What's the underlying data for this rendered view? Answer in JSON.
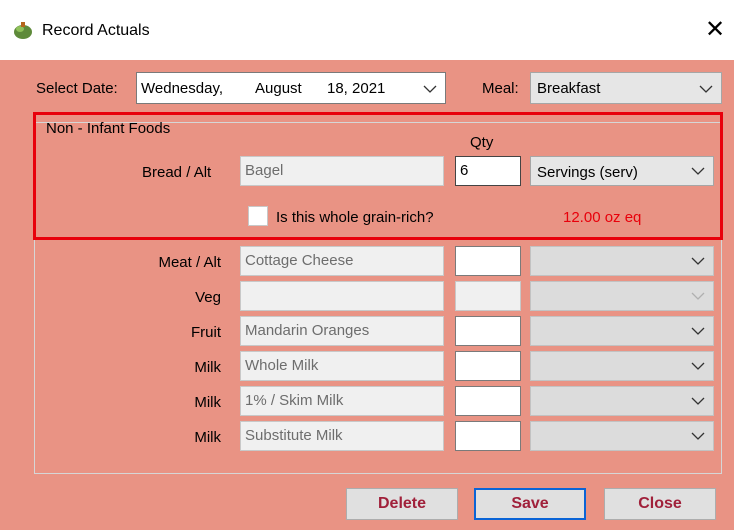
{
  "window": {
    "title": "Record Actuals",
    "close_glyph": "✕"
  },
  "date": {
    "label": "Select Date:",
    "weekday": "Wednesday,",
    "month": "August",
    "day_year": "18, 2021"
  },
  "meal": {
    "label": "Meal:",
    "value": "Breakfast"
  },
  "non_infant": {
    "group_label": "Non - Infant Foods",
    "qty_header": "Qty",
    "bread": {
      "label": "Bread / Alt",
      "food": "Bagel",
      "qty": "6",
      "unit": "Servings (serv)"
    },
    "whole_grain_label": "Is this whole grain-rich?",
    "oz_eq": "12.00 oz eq"
  },
  "rows": [
    {
      "label": "Meat / Alt",
      "food": "Cottage Cheese"
    },
    {
      "label": "Veg",
      "food": ""
    },
    {
      "label": "Fruit",
      "food": "Mandarin Oranges"
    },
    {
      "label": "Milk",
      "food": "Whole Milk"
    },
    {
      "label": "Milk",
      "food": "1% / Skim Milk"
    },
    {
      "label": "Milk",
      "food": "Substitute Milk"
    }
  ],
  "buttons": {
    "delete": "Delete",
    "save": "Save",
    "close": "Close"
  },
  "colors": {
    "background": "#e99384",
    "highlight": "#e8000b",
    "button_text": "#a0203a",
    "oz_text": "#e8000b"
  }
}
